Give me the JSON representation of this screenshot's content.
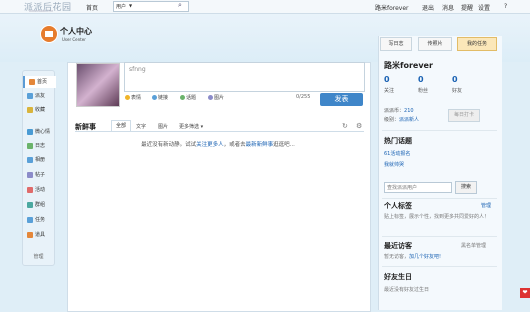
{
  "topbar": {
    "logo": "派派后花园",
    "logo_sub": "WWW.PAIPAI.FM",
    "home": "首页",
    "search_type": "用户",
    "right": {
      "user": "路米forever",
      "logout": "退出",
      "messages": "消息",
      "notify": "提醒",
      "settings": "设置",
      "help": "?"
    }
  },
  "header": {
    "title": "个人中心",
    "subtitle": "User Center"
  },
  "sidebar": {
    "items": [
      {
        "label": "首页",
        "icon": "home-icon",
        "color": "#e4873a"
      },
      {
        "label": "派友",
        "icon": "friends-icon",
        "color": "#5aa0d8"
      },
      {
        "label": "收藏",
        "icon": "star-icon",
        "color": "#d9b43c"
      },
      {
        "label": "微心情",
        "icon": "mood-icon",
        "color": "#4a9bd4"
      },
      {
        "label": "日志",
        "icon": "blog-icon",
        "color": "#6bb36b"
      },
      {
        "label": "相册",
        "icon": "album-icon",
        "color": "#5aa0d8"
      },
      {
        "label": "帖子",
        "icon": "post-icon",
        "color": "#8b8bc9"
      },
      {
        "label": "活动",
        "icon": "event-icon",
        "color": "#e06b6b"
      },
      {
        "label": "群组",
        "icon": "group-icon",
        "color": "#4ba8a0"
      },
      {
        "label": "任务",
        "icon": "task-icon",
        "color": "#5aa0d8"
      },
      {
        "label": "道具",
        "icon": "props-icon",
        "color": "#e4873a"
      }
    ],
    "manage": "管理"
  },
  "composer": {
    "input_value": "sfnng",
    "tools": [
      "表情",
      "链接",
      "话题",
      "图片"
    ],
    "count": "0/255",
    "publish": "发表"
  },
  "feed": {
    "title": "新鲜事",
    "tabs": [
      "全部",
      "文字",
      "图片",
      "更多筛选 ▾"
    ],
    "empty_pre": "最近没有新动静。试试",
    "empty_link1": "关注更多人",
    "empty_mid": "，或者去",
    "empty_link2": "最新新鲜事",
    "empty_post": "逛逛吧..."
  },
  "right": {
    "buttons": [
      "写日志",
      "传照片",
      "我的任务"
    ],
    "username": "路米forever",
    "stats": [
      {
        "num": "0",
        "label": "关注"
      },
      {
        "num": "0",
        "label": "粉丝"
      },
      {
        "num": "0",
        "label": "好友"
      }
    ],
    "score_label": "派派币：",
    "score_value": "210",
    "level_label": "级别：",
    "level_value": "派派新人",
    "signin": "每日打卡",
    "hot_title": "热门话题",
    "hot_items": [
      "61活动报名",
      "我就帅哭"
    ],
    "user_search_placeholder": "查找派派用户",
    "user_search_btn": "搜索",
    "tags_title": "个人标签",
    "tags_manage": "管理",
    "tags_text": "贴上标签，展示个性，找到更多共同爱好的人！",
    "visitors_title": "最近访客",
    "visitors_link": "黑名单管理",
    "visitors_text": "暂无访客，",
    "visitors_action": "加几个好友吧!",
    "birthday_title": "好友生日",
    "birthday_text": "最近没有好友过生日"
  },
  "corner": "❤"
}
